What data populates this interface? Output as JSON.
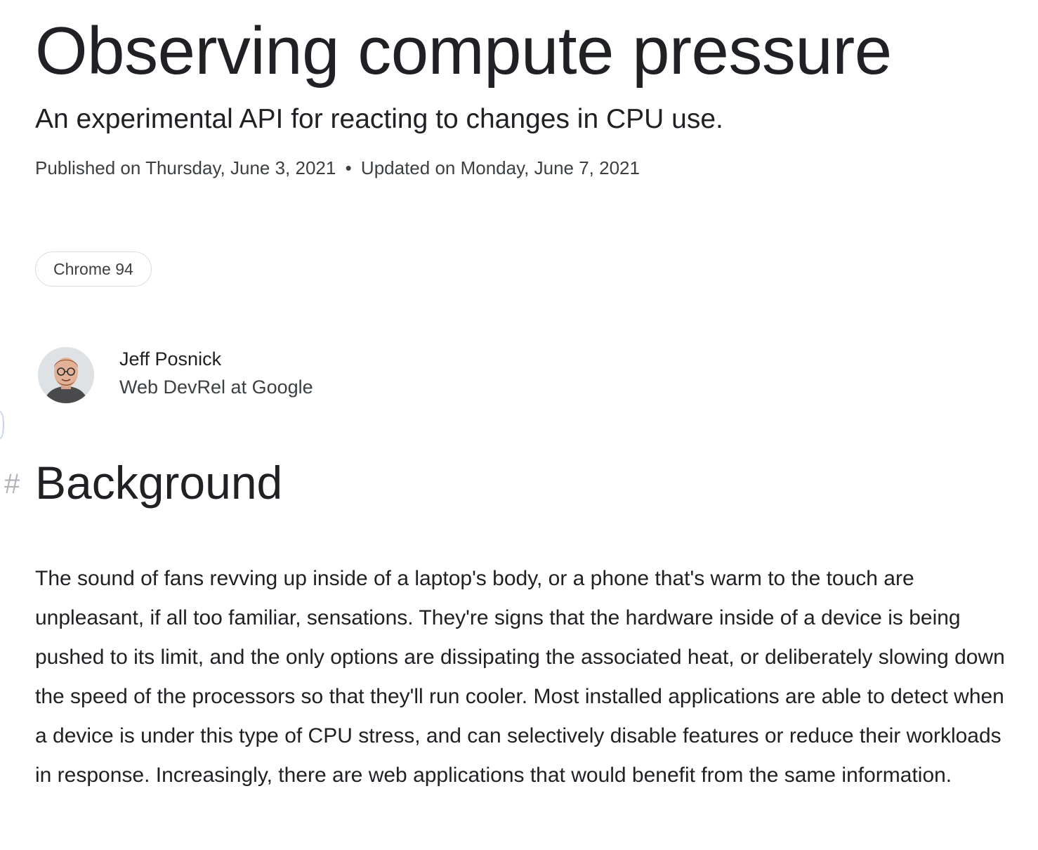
{
  "article": {
    "title": "Observing compute pressure",
    "subtitle": "An experimental API for reacting to changes in CPU use.",
    "published": "Published on Thursday, June 3, 2021",
    "separator": "•",
    "updated": "Updated on Monday, June 7, 2021",
    "chip_label": "Chrome 94"
  },
  "author": {
    "name": "Jeff Posnick",
    "role": "Web DevRel at Google"
  },
  "section": {
    "anchor": "#",
    "heading": "Background",
    "paragraph": "The sound of fans revving up inside of a laptop's body, or a phone that's warm to the touch are unpleasant, if all too familiar, sensations. They're signs that the hardware inside of a device is being pushed to its limit, and the only options are dissipating the associated heat, or deliberately slowing down the speed of the processors so that they'll run cooler. Most installed applications are able to detect when a device is under this type of CPU stress, and can selectively disable features or reduce their workloads in response. Increasingly, there are web applications that would benefit from the same information."
  },
  "colors": {
    "text_primary": "#202124",
    "text_secondary": "#3c4043",
    "chip_border": "#dadce0",
    "anchor": "#b0b4b8"
  }
}
